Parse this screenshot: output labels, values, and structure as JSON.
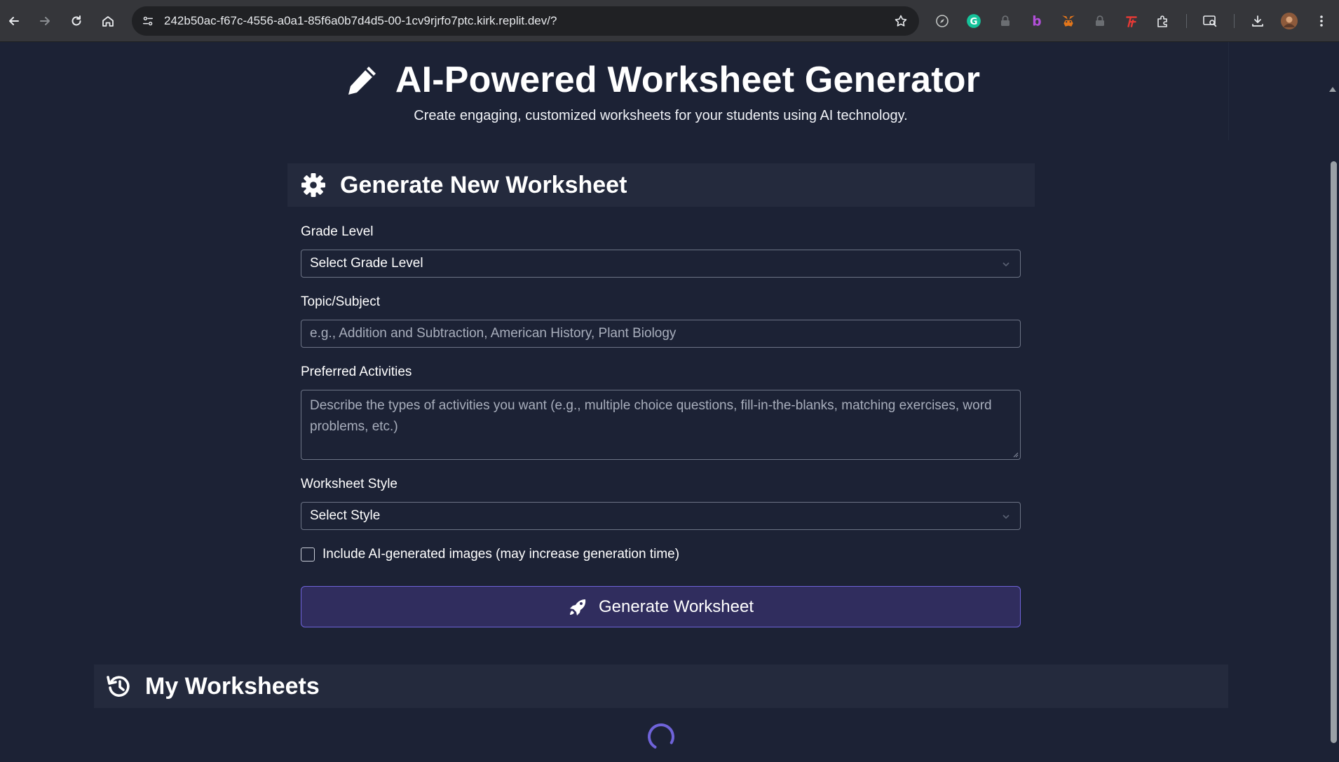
{
  "browser": {
    "url": "242b50ac-f67c-4556-a0a1-85f6a0b7d4d5-00-1cv9rjrfo7ptc.kirk.replit.dev/?",
    "icons": [
      "back-icon",
      "forward-icon",
      "reload-icon",
      "home-icon",
      "site-settings-icon",
      "bookmark-star-icon",
      "compass-extension-icon",
      "grammarly-extension-icon",
      "lock-extension-icon",
      "b-extension-icon",
      "metamask-extension-icon",
      "lock-extension-icon",
      "red-extension-icon",
      "extensions-puzzle-icon",
      "media-search-icon",
      "download-icon",
      "profile-avatar-icon",
      "menu-dots-icon"
    ]
  },
  "header": {
    "title": "AI-Powered Worksheet Generator",
    "subtitle": "Create engaging, customized worksheets for your students using AI technology.",
    "icon": "pencil-icon"
  },
  "form": {
    "card_title": "Generate New Worksheet",
    "card_icon": "gear-icon",
    "grade_label": "Grade Level",
    "grade_value": "Select Grade Level",
    "topic_label": "Topic/Subject",
    "topic_placeholder": "e.g., Addition and Subtraction, American History, Plant Biology",
    "activities_label": "Preferred Activities",
    "activities_placeholder": "Describe the types of activities you want (e.g., multiple choice questions, fill-in-the-blanks, matching exercises, word problems, etc.)",
    "style_label": "Worksheet Style",
    "style_value": "Select Style",
    "images_checkbox_label": "Include AI-generated images (may increase generation time)",
    "images_checked": false,
    "submit_label": "Generate Worksheet",
    "submit_icon": "rocket-icon"
  },
  "worksheets": {
    "title": "My Worksheets",
    "icon": "history-icon",
    "loading": true
  },
  "colors": {
    "background": "#1c2235",
    "card_header": "#242a3d",
    "accent": "#6f63d9",
    "button_bg": "#302d5e"
  }
}
